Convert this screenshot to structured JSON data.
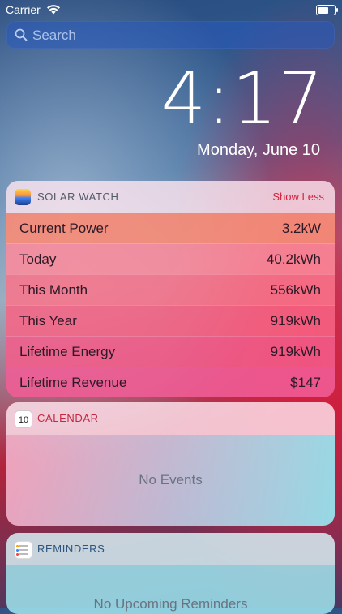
{
  "status_bar": {
    "carrier": "Carrier"
  },
  "search": {
    "placeholder": "Search"
  },
  "lockscreen": {
    "time": "4:17",
    "date": "Monday, June 10"
  },
  "solar_widget": {
    "title": "SOLAR WATCH",
    "action": "Show Less",
    "rows": [
      {
        "label": "Current Power",
        "value": "3.2kW"
      },
      {
        "label": "Today",
        "value": "40.2kWh"
      },
      {
        "label": "This Month",
        "value": "556kWh"
      },
      {
        "label": "This Year",
        "value": "919kWh"
      },
      {
        "label": "Lifetime Energy",
        "value": "919kWh"
      },
      {
        "label": "Lifetime Revenue",
        "value": "$147"
      }
    ]
  },
  "calendar_widget": {
    "title": "CALENDAR",
    "icon_day": "10",
    "empty_text": "No Events"
  },
  "reminders_widget": {
    "title": "REMINDERS",
    "empty_text": "No Upcoming Reminders"
  },
  "colors": {
    "accent_red": "#d0243c",
    "highlight_row": "#f59678"
  }
}
